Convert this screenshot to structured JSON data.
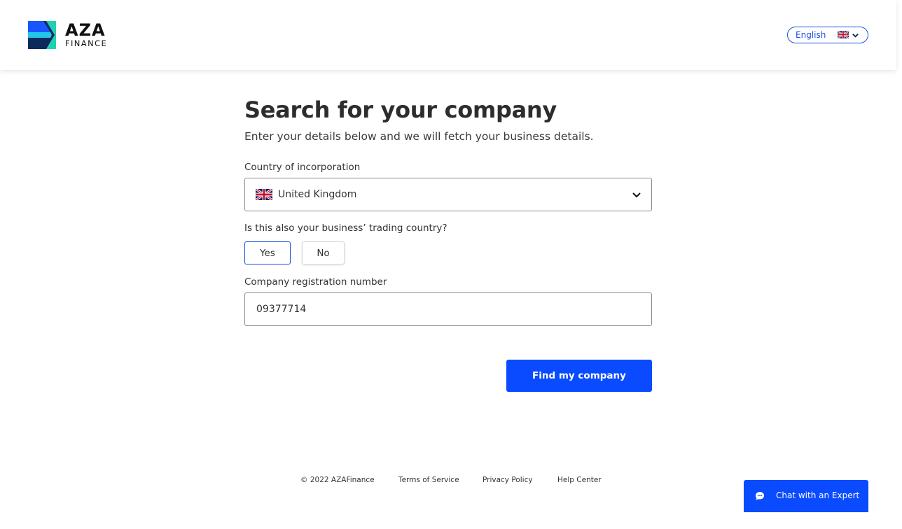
{
  "header": {
    "logo": {
      "primary": "AZA",
      "secondary": "FINANCE"
    },
    "language": {
      "label": "English",
      "flag_icon": "uk-flag-icon",
      "chevron_icon": "chevron-down-icon"
    }
  },
  "form": {
    "title": "Search for your company",
    "subtitle": "Enter your details below and we will fetch your business details.",
    "country": {
      "label": "Country of incorporation",
      "selected": "United Kingdom",
      "flag_icon": "uk-flag-icon"
    },
    "trading_country": {
      "question": "Is this also your business’ trading country?",
      "yes_label": "Yes",
      "no_label": "No",
      "selected": "Yes"
    },
    "registration": {
      "label": "Company registration number",
      "value": "09377714"
    },
    "submit_label": "Find my company"
  },
  "footer": {
    "copyright": "© 2022 AZAFinance",
    "terms": "Terms of Service",
    "privacy": "Privacy Policy",
    "help": "Help Center"
  },
  "chat": {
    "label": "Chat with an Expert",
    "icon": "chat-bubble-icon"
  },
  "colors": {
    "accent": "#0a4bff",
    "outline_accent": "#1b4fe0",
    "logo_teal": "#1fd1b3",
    "logo_navy": "#0e2a5a"
  }
}
